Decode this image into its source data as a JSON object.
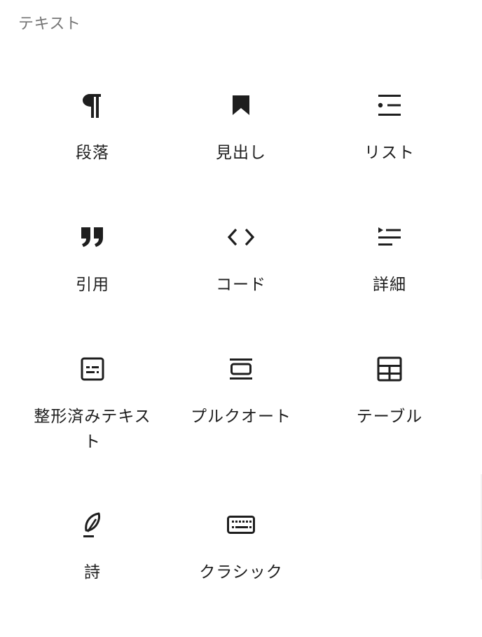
{
  "category": {
    "title": "テキスト"
  },
  "blocks": [
    {
      "label": "段落",
      "icon": "paragraph-icon"
    },
    {
      "label": "見出し",
      "icon": "heading-bookmark-icon"
    },
    {
      "label": "リスト",
      "icon": "list-icon"
    },
    {
      "label": "引用",
      "icon": "quote-icon"
    },
    {
      "label": "コード",
      "icon": "code-icon"
    },
    {
      "label": "詳細",
      "icon": "details-icon"
    },
    {
      "label": "整形済みテキスト",
      "icon": "preformatted-icon"
    },
    {
      "label": "プルクオート",
      "icon": "pullquote-icon"
    },
    {
      "label": "テーブル",
      "icon": "table-icon"
    },
    {
      "label": "詩",
      "icon": "verse-feather-icon"
    },
    {
      "label": "クラシック",
      "icon": "keyboard-icon"
    }
  ],
  "colors": {
    "text": "#1e1e1e",
    "category_title": "#757575",
    "background": "#ffffff"
  }
}
